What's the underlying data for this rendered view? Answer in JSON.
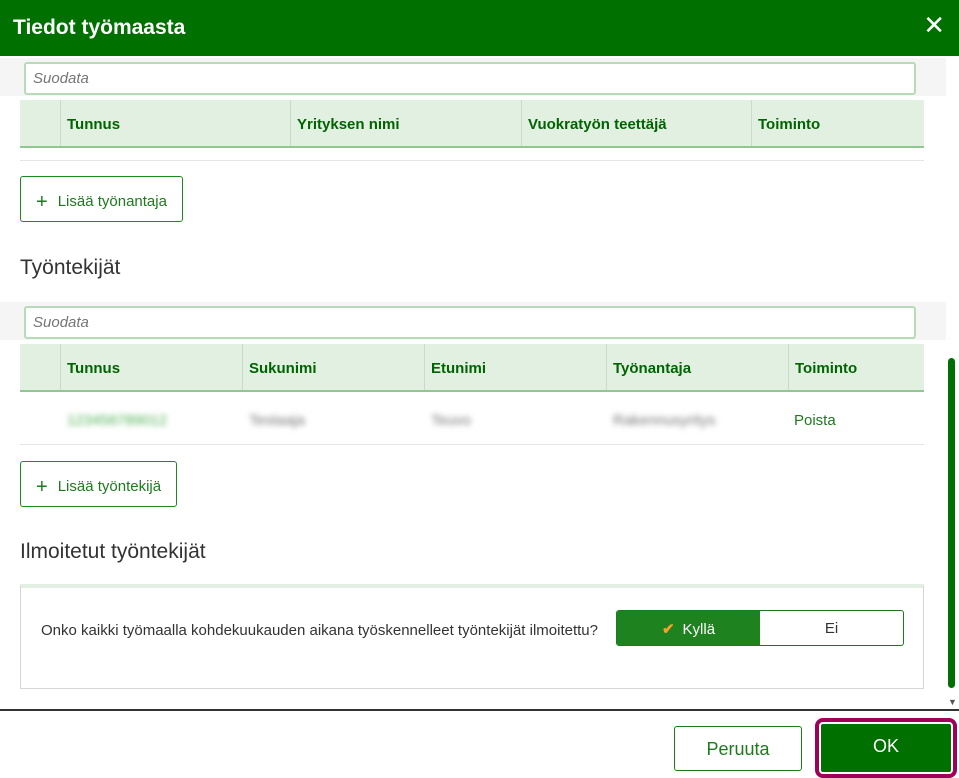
{
  "header": {
    "title": "Tiedot työmaasta",
    "close_icon": "close-icon"
  },
  "employers": {
    "filter_placeholder": "Suodata",
    "columns": [
      "Tunnus",
      "Yrityksen nimi",
      "Vuokratyön teettäjä",
      "Toiminto"
    ],
    "add_label": "Lisää työnantaja"
  },
  "employees": {
    "heading": "Työntekijät",
    "filter_placeholder": "Suodata",
    "columns": [
      "Tunnus",
      "Sukunimi",
      "Etunimi",
      "Työnantaja",
      "Toiminto"
    ],
    "rows": [
      {
        "id": "123456789012",
        "surname": "Testaaja",
        "firstname": "Teuvo",
        "employer": "Rakennusyritys",
        "action": "Poista"
      }
    ],
    "add_label": "Lisää työntekijä"
  },
  "reported": {
    "heading": "Ilmoitetut työntekijät",
    "question": "Onko kaikki työmaalla kohdekuukauden aikana työskennelleet työntekijät ilmoitettu?",
    "yes": "Kyllä",
    "no": "Ei",
    "selected": "yes"
  },
  "footer": {
    "cancel": "Peruuta",
    "ok": "OK"
  },
  "colors": {
    "brand": "#007000",
    "focus": "#a0005a",
    "check": "#f7a12a"
  }
}
